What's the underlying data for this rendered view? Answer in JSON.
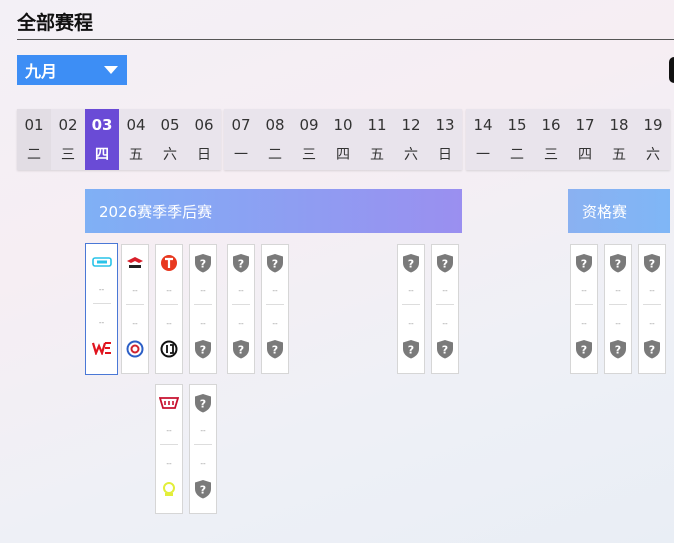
{
  "page": {
    "title": "全部赛程"
  },
  "month_select": {
    "value": "九月"
  },
  "calendar": {
    "weeks": [
      {
        "days": [
          {
            "d": "01",
            "w": "二"
          },
          {
            "d": "02",
            "w": "三"
          },
          {
            "d": "03",
            "w": "四",
            "active": true
          },
          {
            "d": "04",
            "w": "五"
          },
          {
            "d": "05",
            "w": "六"
          },
          {
            "d": "06",
            "w": "日"
          }
        ]
      },
      {
        "days": [
          {
            "d": "07",
            "w": "一"
          },
          {
            "d": "08",
            "w": "二"
          },
          {
            "d": "09",
            "w": "三"
          },
          {
            "d": "10",
            "w": "四"
          },
          {
            "d": "11",
            "w": "五"
          },
          {
            "d": "12",
            "w": "六"
          },
          {
            "d": "13",
            "w": "日"
          }
        ]
      },
      {
        "days": [
          {
            "d": "14",
            "w": "一"
          },
          {
            "d": "15",
            "w": "二"
          },
          {
            "d": "16",
            "w": "三"
          },
          {
            "d": "17",
            "w": "四"
          },
          {
            "d": "18",
            "w": "五"
          },
          {
            "d": "19",
            "w": "六"
          }
        ]
      }
    ]
  },
  "stages": [
    {
      "label": "2026赛季季后赛"
    },
    {
      "label": "资格赛"
    }
  ],
  "matches": {
    "score_placeholder": "--",
    "items": [
      {
        "team_top": "team-logo-cyan",
        "team_bottom": "team-logo-we"
      },
      {
        "team_top": "team-logo-red-wing",
        "team_bottom": "team-logo-blue-ring"
      },
      {
        "team_top": "team-logo-tes",
        "team_bottom": "team-logo-ig"
      },
      {
        "team_top": "tbd-shield-icon",
        "team_bottom": "tbd-shield-icon"
      },
      {
        "team_top": "tbd-shield-icon",
        "team_bottom": "tbd-shield-icon"
      },
      {
        "team_top": "tbd-shield-icon",
        "team_bottom": "tbd-shield-icon"
      },
      {
        "team_top": "tbd-shield-icon",
        "team_bottom": "tbd-shield-icon"
      },
      {
        "team_top": "tbd-shield-icon",
        "team_bottom": "tbd-shield-icon"
      },
      {
        "team_top": "tbd-shield-icon",
        "team_bottom": "tbd-shield-icon"
      },
      {
        "team_top": "tbd-shield-icon",
        "team_bottom": "tbd-shield-icon"
      },
      {
        "team_top": "tbd-shield-icon",
        "team_bottom": "tbd-shield-icon"
      },
      {
        "team_top": "team-logo-jdg",
        "team_bottom": "team-logo-lime"
      },
      {
        "team_top": "tbd-shield-icon",
        "team_bottom": "tbd-shield-icon"
      }
    ]
  },
  "colors": {
    "accent": "#3d8ef5",
    "active_day": "#6a4bd6",
    "tbd_icon": "#7a7a7a"
  }
}
